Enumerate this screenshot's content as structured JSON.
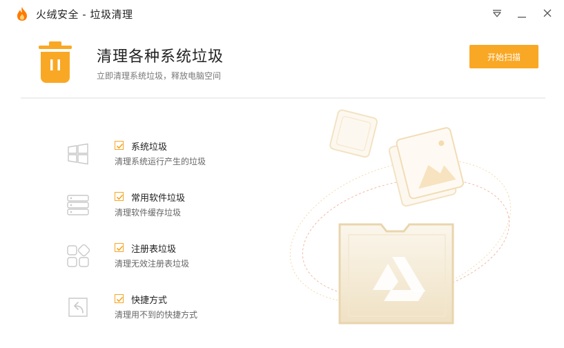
{
  "window": {
    "title": "火绒安全 - 垃圾清理",
    "controls": [
      "menu-icon",
      "minimize-icon",
      "close-icon"
    ]
  },
  "header": {
    "title": "清理各种系统垃圾",
    "subtitle": "立即清理系统垃圾，释放电脑空间",
    "scan_button": "开始扫描",
    "icon": "trash-can-icon"
  },
  "items": [
    {
      "title": "系统垃圾",
      "desc": "清理系统运行产生的垃圾",
      "checked": true,
      "icon": "windows-icon"
    },
    {
      "title": "常用软件垃圾",
      "desc": "清理软件缓存垃圾",
      "checked": true,
      "icon": "server-stack-icon"
    },
    {
      "title": "注册表垃圾",
      "desc": "清理无效注册表垃圾",
      "checked": true,
      "icon": "registry-grid-icon"
    },
    {
      "title": "快捷方式",
      "desc": "清理用不到的快捷方式",
      "checked": true,
      "icon": "shortcut-icon"
    }
  ],
  "colors": {
    "accent": "#f9a825",
    "checkbox": "#f5a623",
    "logo": "#ff7a00",
    "muted_icon": "#c8c8c8"
  }
}
